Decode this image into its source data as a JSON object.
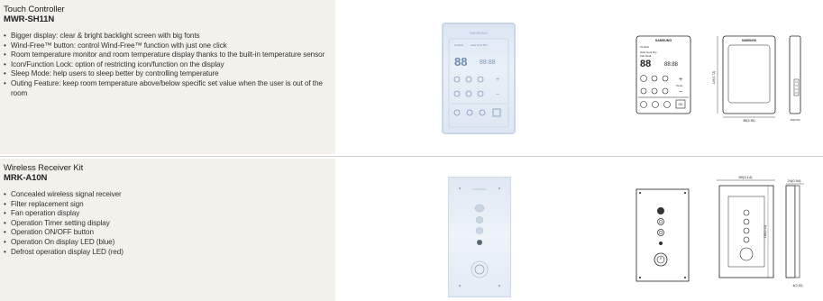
{
  "products": [
    {
      "title": "Touch Controller",
      "model": "MWR-SH11N",
      "features": [
        "Bigger display: clear & bright backlight screen with big fonts",
        "Wind-Free™ button: control Wind-Free™ function with just one click",
        "Room temperature monitor and room temperature display thanks to the built-in temperature sensor",
        "Icon/Function Lock: option of restricting icon/function on the display",
        "Sleep Mode: help users to sleep better by controlling temperature",
        "Outing Feature: keep room temperature above/below specific set value when the user is out of the room"
      ],
      "photo_brand": "SAMSUNG",
      "drawing": {
        "brand": "SAMSUNG",
        "dim_height": "119(4.72)",
        "dim_width": "85(3.35)",
        "dim_depth": "16(0.63)",
        "screen_text": [
          "Central",
          "Auto Cool Dry",
          "Fan Heat",
          "88",
          "88:88",
          "Temp",
          "OK"
        ]
      }
    },
    {
      "title": "Wireless Receiver Kit",
      "model": "MRK-A10N",
      "features": [
        "Concealed wireless signal receiver",
        "Filter replacement sign",
        "Fan operation display",
        "Operation Timer setting display",
        "Operation ON/OFF button",
        "Operation On display LED (blue)",
        "Defrost operation display LED (red)"
      ],
      "photo_brand": "SAMSUNG",
      "drawing": {
        "dim_width": "80(3.14)",
        "dim_depth": "24(0.94)",
        "dim_height": "130(5.11)",
        "dim_small": "4(0.15)"
      }
    }
  ]
}
